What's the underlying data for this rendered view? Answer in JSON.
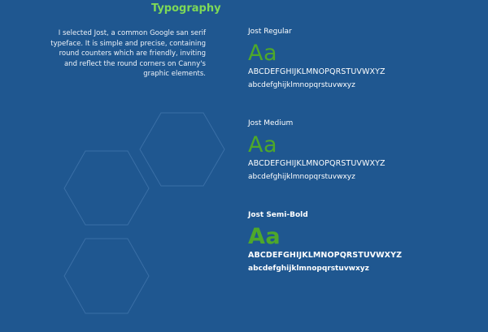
{
  "section": {
    "title": "Typography",
    "description": "I selected Jost, a common Google san serif typeface. It is simple and precise, containing round counters which are friendly, inviting and reflect the round corners on Canny's graphic elements."
  },
  "colors": {
    "background": "#1f5790",
    "title": "#7ed957",
    "sample_glyph": "#4ea82a",
    "hexagon_outline": "#3a6fa6"
  },
  "fonts": [
    {
      "name": "Jost Regular",
      "sample": "Aa",
      "uppercase": "ABCDEFGHIJKLMNOPQRSTUVWXYZ",
      "lowercase": "abcdefghijklmnopqrstuvwxyz"
    },
    {
      "name": "Jost Medium",
      "sample": "Aa",
      "uppercase": "ABCDEFGHIJKLMNOPQRSTUVWXYZ",
      "lowercase": "abcdefghijklmnopqrstuvwxyz"
    },
    {
      "name": "Jost Semi-Bold",
      "sample": "Aa",
      "uppercase": "ABCDEFGHIJKLMNOPQRSTUVWXYZ",
      "lowercase": "abcdefghijklmnopqrstuvwxyz"
    }
  ]
}
